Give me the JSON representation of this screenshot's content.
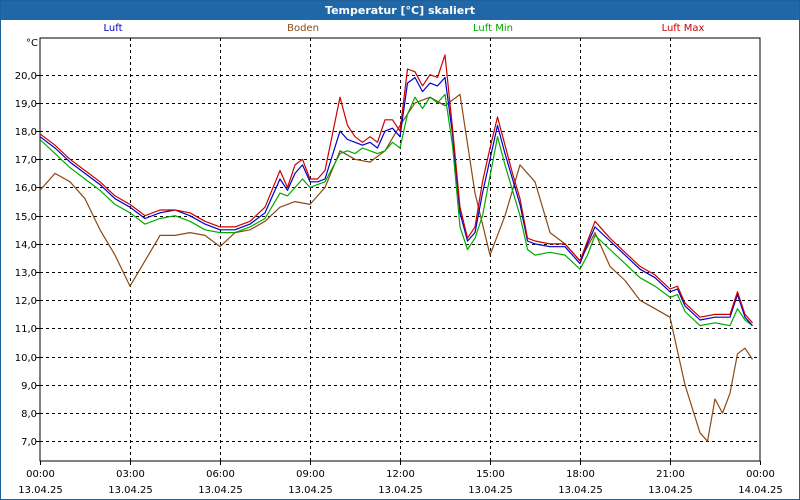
{
  "window": {
    "title": "Temperatur [°C] skaliert"
  },
  "chart_data": {
    "type": "line",
    "title": "Temperatur [°C] skaliert",
    "ylabel": "°C",
    "xlabel": "",
    "ylim": [
      6.3,
      21.3
    ],
    "xlim": [
      0,
      24
    ],
    "grid": true,
    "legend_position": "top",
    "y_ticks": [
      "7,0",
      "8,0",
      "9,0",
      "10,0",
      "11,0",
      "12,0",
      "13,0",
      "14,0",
      "15,0",
      "16,0",
      "17,0",
      "18,0",
      "19,0",
      "20,0"
    ],
    "x_ticks": [
      {
        "time": "00:00",
        "date": "13.04.25"
      },
      {
        "time": "03:00",
        "date": "13.04.25"
      },
      {
        "time": "06:00",
        "date": "13.04.25"
      },
      {
        "time": "09:00",
        "date": "13.04.25"
      },
      {
        "time": "12:00",
        "date": "13.04.25"
      },
      {
        "time": "15:00",
        "date": "13.04.25"
      },
      {
        "time": "18:00",
        "date": "13.04.25"
      },
      {
        "time": "21:00",
        "date": "13.04.25"
      },
      {
        "time": "00:00",
        "date": "14.04.25"
      }
    ],
    "series": [
      {
        "name": "Luft",
        "color": "#0000cc",
        "x": [
          0,
          0.5,
          1.0,
          1.5,
          2.0,
          2.5,
          3.0,
          3.5,
          4.0,
          4.5,
          5.0,
          5.5,
          6.0,
          6.5,
          7.0,
          7.5,
          8.0,
          8.25,
          8.5,
          8.75,
          9.0,
          9.25,
          9.5,
          10.0,
          10.25,
          10.5,
          10.75,
          11.0,
          11.25,
          11.5,
          11.75,
          12.0,
          12.25,
          12.5,
          12.75,
          13.0,
          13.25,
          13.5,
          13.75,
          14.0,
          14.25,
          14.5,
          14.75,
          15.0,
          15.25,
          15.5,
          15.75,
          16.0,
          16.25,
          16.5,
          17.0,
          17.5,
          18.0,
          18.25,
          18.5,
          19.0,
          19.5,
          20.0,
          20.5,
          21.0,
          21.25,
          21.5,
          22.0,
          22.5,
          23.0,
          23.25,
          23.5,
          23.75
        ],
        "y": [
          17.8,
          17.4,
          16.9,
          16.5,
          16.1,
          15.6,
          15.3,
          14.9,
          15.1,
          15.2,
          15.0,
          14.7,
          14.5,
          14.5,
          14.7,
          15.1,
          16.3,
          15.9,
          16.5,
          16.8,
          16.2,
          16.2,
          16.3,
          18.0,
          17.7,
          17.6,
          17.5,
          17.6,
          17.4,
          18.0,
          18.1,
          17.8,
          19.7,
          19.9,
          19.4,
          19.7,
          19.6,
          19.9,
          17.9,
          15.1,
          14.1,
          14.4,
          15.8,
          17.0,
          18.2,
          17.2,
          16.3,
          15.4,
          14.1,
          14.0,
          13.9,
          13.9,
          13.3,
          14.0,
          14.6,
          14.1,
          13.6,
          13.1,
          12.8,
          12.3,
          12.4,
          11.8,
          11.3,
          11.4,
          11.4,
          12.2,
          11.4,
          11.1
        ]
      },
      {
        "name": "Boden",
        "color": "#8b4a14",
        "x": [
          0,
          0.5,
          1.0,
          1.5,
          2.0,
          2.5,
          3.0,
          3.5,
          4.0,
          4.5,
          5.0,
          5.5,
          6.0,
          6.5,
          7.0,
          7.5,
          8.0,
          8.5,
          9.0,
          9.5,
          10.0,
          10.5,
          11.0,
          11.5,
          12.0,
          12.5,
          13.0,
          13.5,
          14.0,
          14.5,
          15.0,
          15.5,
          16.0,
          16.5,
          17.0,
          17.5,
          18.0,
          18.5,
          19.0,
          19.5,
          20.0,
          20.5,
          21.0,
          21.5,
          22.0,
          22.25,
          22.5,
          22.75,
          23.0,
          23.25,
          23.5,
          23.75
        ],
        "y": [
          15.9,
          16.5,
          16.2,
          15.6,
          14.5,
          13.6,
          12.5,
          13.4,
          14.3,
          14.3,
          14.4,
          14.3,
          13.9,
          14.4,
          14.5,
          14.8,
          15.3,
          15.5,
          15.4,
          16.0,
          17.3,
          17.0,
          16.9,
          17.3,
          18.2,
          19.0,
          19.2,
          18.9,
          19.3,
          15.8,
          13.6,
          15.0,
          16.8,
          16.2,
          14.4,
          14.0,
          13.4,
          14.4,
          13.2,
          12.7,
          12.0,
          11.7,
          11.4,
          9.0,
          7.3,
          7.0,
          8.5,
          8.0,
          8.7,
          10.1,
          10.3,
          9.9
        ]
      },
      {
        "name": "Luft Min",
        "color": "#00aa00",
        "x": [
          0,
          0.5,
          1.0,
          1.5,
          2.0,
          2.5,
          3.0,
          3.5,
          4.0,
          4.5,
          5.0,
          5.5,
          6.0,
          6.5,
          7.0,
          7.5,
          8.0,
          8.25,
          8.5,
          8.75,
          9.0,
          9.25,
          9.5,
          10.0,
          10.25,
          10.5,
          10.75,
          11.0,
          11.25,
          11.5,
          11.75,
          12.0,
          12.25,
          12.5,
          12.75,
          13.0,
          13.25,
          13.5,
          13.75,
          14.0,
          14.25,
          14.5,
          14.75,
          15.0,
          15.25,
          15.5,
          15.75,
          16.0,
          16.25,
          16.5,
          17.0,
          17.5,
          18.0,
          18.25,
          18.5,
          19.0,
          19.5,
          20.0,
          20.5,
          21.0,
          21.25,
          21.5,
          22.0,
          22.5,
          23.0,
          23.25,
          23.5,
          23.75
        ],
        "y": [
          17.7,
          17.2,
          16.7,
          16.3,
          15.9,
          15.4,
          15.1,
          14.7,
          14.9,
          15.0,
          14.8,
          14.5,
          14.4,
          14.4,
          14.6,
          14.9,
          15.8,
          15.7,
          16.0,
          16.3,
          16.0,
          16.1,
          16.2,
          17.2,
          17.3,
          17.2,
          17.4,
          17.3,
          17.2,
          17.3,
          17.6,
          17.4,
          18.6,
          19.2,
          18.8,
          19.2,
          19.0,
          19.3,
          17.5,
          14.6,
          13.8,
          14.2,
          15.0,
          16.4,
          17.8,
          16.8,
          15.9,
          15.0,
          13.8,
          13.6,
          13.7,
          13.6,
          13.1,
          13.6,
          14.3,
          13.8,
          13.3,
          12.8,
          12.5,
          12.1,
          12.2,
          11.6,
          11.1,
          11.2,
          11.1,
          11.7,
          11.3,
          11.1
        ]
      },
      {
        "name": "Luft Max",
        "color": "#cc0000",
        "x": [
          0,
          0.5,
          1.0,
          1.5,
          2.0,
          2.5,
          3.0,
          3.5,
          4.0,
          4.5,
          5.0,
          5.5,
          6.0,
          6.5,
          7.0,
          7.5,
          8.0,
          8.25,
          8.5,
          8.75,
          9.0,
          9.25,
          9.5,
          10.0,
          10.25,
          10.5,
          10.75,
          11.0,
          11.25,
          11.5,
          11.75,
          12.0,
          12.25,
          12.5,
          12.75,
          13.0,
          13.25,
          13.5,
          13.75,
          14.0,
          14.25,
          14.5,
          14.75,
          15.0,
          15.25,
          15.5,
          15.75,
          16.0,
          16.25,
          16.5,
          17.0,
          17.5,
          18.0,
          18.25,
          18.5,
          19.0,
          19.5,
          20.0,
          20.5,
          21.0,
          21.25,
          21.5,
          22.0,
          22.5,
          23.0,
          23.25,
          23.5,
          23.75
        ],
        "y": [
          17.9,
          17.5,
          17.0,
          16.6,
          16.2,
          15.7,
          15.4,
          15.0,
          15.2,
          15.2,
          15.1,
          14.8,
          14.6,
          14.6,
          14.8,
          15.3,
          16.6,
          16.0,
          16.8,
          17.0,
          16.3,
          16.3,
          16.6,
          19.2,
          18.2,
          17.8,
          17.6,
          17.8,
          17.6,
          18.4,
          18.4,
          18.0,
          20.2,
          20.1,
          19.6,
          20.0,
          19.9,
          20.7,
          18.1,
          15.3,
          14.2,
          14.6,
          16.2,
          17.4,
          18.5,
          17.5,
          16.5,
          15.6,
          14.2,
          14.1,
          14.0,
          14.0,
          13.4,
          14.1,
          14.8,
          14.2,
          13.7,
          13.2,
          12.9,
          12.4,
          12.5,
          11.9,
          11.4,
          11.5,
          11.5,
          12.3,
          11.5,
          11.2
        ]
      }
    ]
  }
}
